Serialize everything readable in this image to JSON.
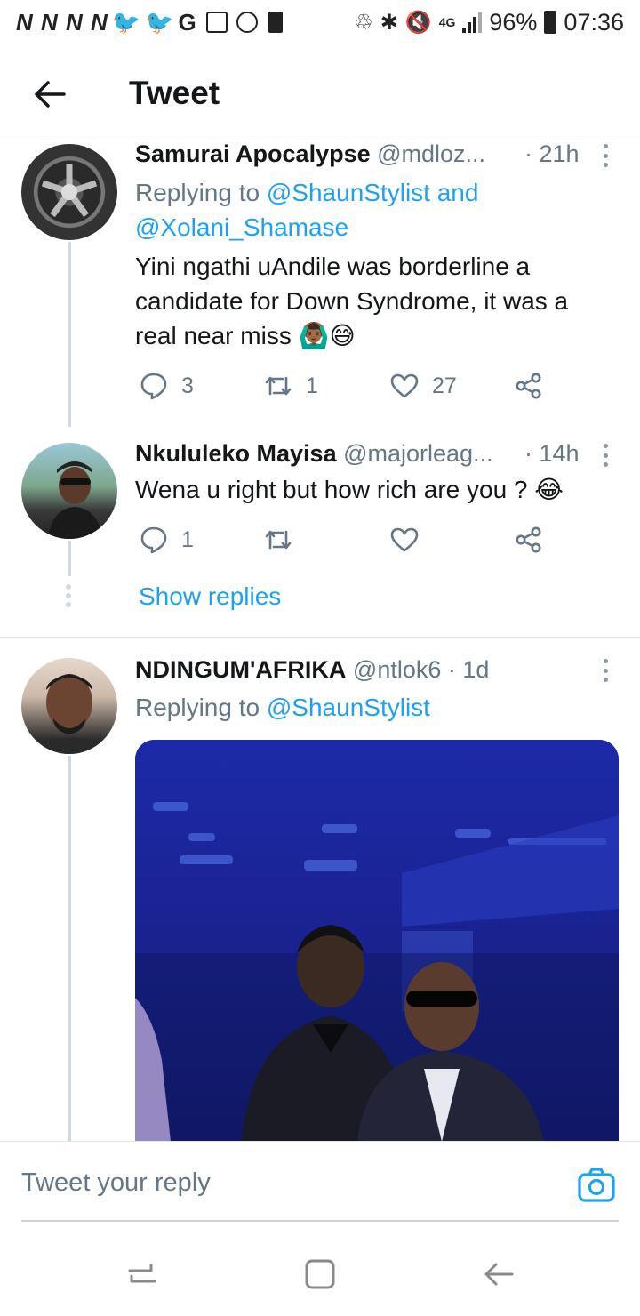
{
  "status_bar": {
    "left_icons": "N N N N",
    "g_label": "G",
    "network": "4G",
    "battery": "96%",
    "time": "07:36"
  },
  "header": {
    "title": "Tweet"
  },
  "tweets": [
    {
      "name": "Samurai Apocalypse",
      "handle": "@mdloz...",
      "time": "· 21h",
      "replying_prefix": "Replying to ",
      "replying_1": "@ShaunStylist",
      "replying_and": " and",
      "replying_2": "@Xolani_Shamase",
      "text_line1": "Yini ngathi uAndile was borderline a",
      "text_line2": "candidate for Down Syndrome, it was a",
      "text_line3": "real near miss 🙆🏾‍♂️😅",
      "replies": "3",
      "retweets": "1",
      "likes": "27"
    },
    {
      "name": "Nkululeko Mayisa",
      "handle": "@majorleag...",
      "time": "· 14h",
      "text_line1": "Wena u right but how rich are you ? 😂",
      "replies": "1",
      "retweets": "",
      "likes": ""
    },
    {
      "name": "NDINGUM'AFRIKA",
      "handle": "@ntlok6",
      "time": "· 1d",
      "replying_prefix": "Replying to ",
      "replying_1": "@ShaunStylist"
    }
  ],
  "show_replies": "Show replies",
  "reply_bar": {
    "placeholder": "Tweet your reply"
  },
  "colors": {
    "accent": "#1da1f2",
    "secondary_text": "#657786",
    "primary_text": "#14171a"
  }
}
